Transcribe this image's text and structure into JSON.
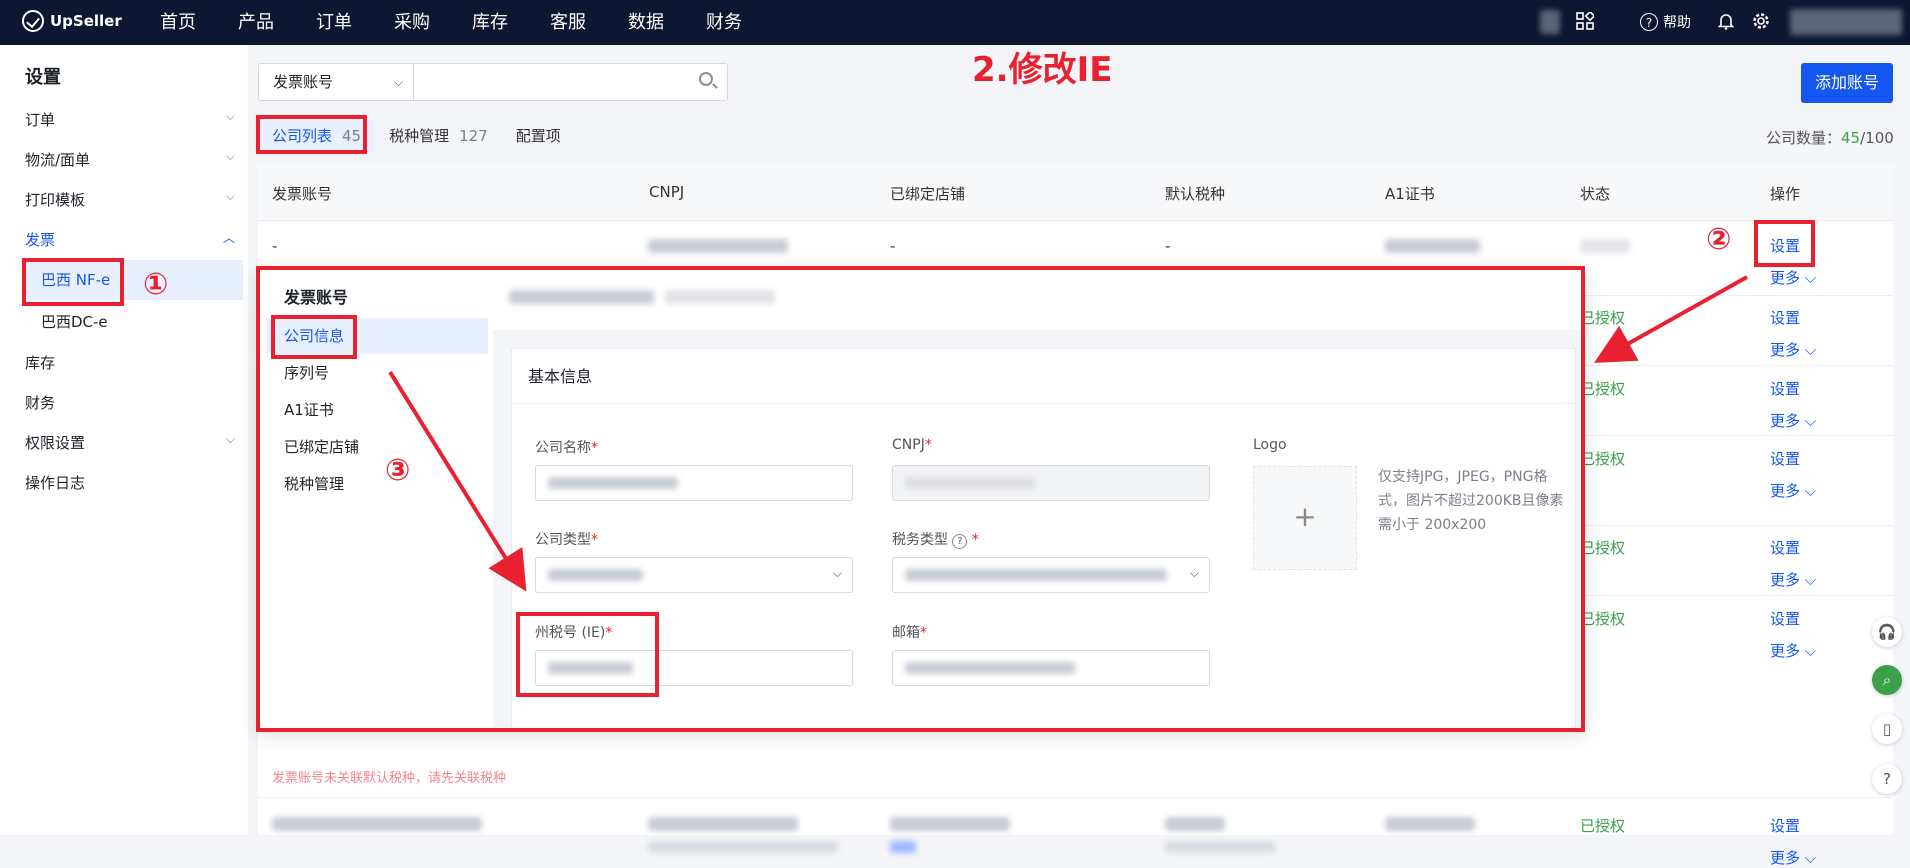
{
  "brand": {
    "name": "UpSeller"
  },
  "nav": [
    "首页",
    "产品",
    "订单",
    "采购",
    "库存",
    "客服",
    "数据",
    "财务"
  ],
  "topbar": {
    "help": "帮助"
  },
  "sidebar": {
    "title": "设置",
    "items": [
      {
        "label": "订单"
      },
      {
        "label": "物流/面单"
      },
      {
        "label": "打印模板"
      },
      {
        "label": "发票"
      },
      {
        "label": "巴西 NF-e"
      },
      {
        "label": "巴西DC-e"
      },
      {
        "label": "库存"
      },
      {
        "label": "财务"
      },
      {
        "label": "权限设置"
      },
      {
        "label": "操作日志"
      }
    ]
  },
  "filter": {
    "select": "发票账号",
    "search_placeholder": ""
  },
  "add_button": "添加账号",
  "tabs": [
    {
      "label": "公司列表",
      "count": "45"
    },
    {
      "label": "税种管理",
      "count": "127"
    },
    {
      "label": "配置项",
      "count": ""
    }
  ],
  "company_count": {
    "label": "公司数量：",
    "used": "45",
    "total": "/100"
  },
  "annotation": {
    "title": "2.修改IE",
    "step1": "①",
    "step2": "②",
    "step3": "③"
  },
  "table": {
    "headers": [
      "发票账号",
      "CNPJ",
      "已绑定店铺",
      "默认税种",
      "A1证书",
      "状态",
      "操作"
    ],
    "row1": {
      "account": "-",
      "store": "-",
      "tax": "-"
    },
    "status_ok": "已授权",
    "action_set": "设置",
    "action_more": "更多 ⌵",
    "warn": "发票账号未关联默认税种，请先关联税种"
  },
  "panel": {
    "side_title": "发票账号",
    "side_items": [
      "公司信息",
      "序列号",
      "A1证书",
      "已绑定店铺",
      "税种管理"
    ],
    "card_title": "基本信息",
    "fields": {
      "company_name": "公司名称",
      "cnpj": "CNPJ",
      "logo": "Logo",
      "company_type": "公司类型",
      "tax_type": "税务类型",
      "state_tax": "州税号 (IE)",
      "email": "邮箱",
      "star": "*"
    },
    "logo_tip": "仅支持JPG，JPEG，PNG格式，图片不超过200KB且像素需小于 200x200"
  }
}
